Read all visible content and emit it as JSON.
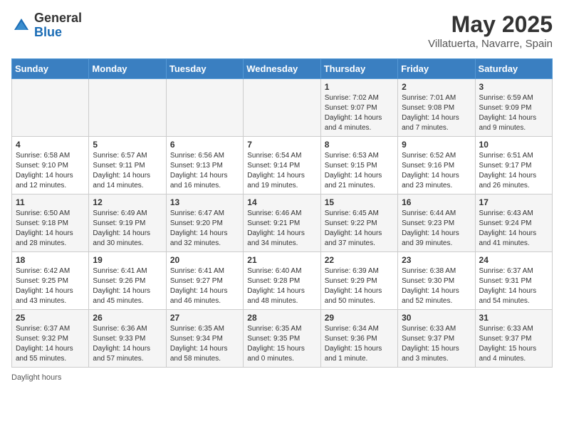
{
  "header": {
    "logo_general": "General",
    "logo_blue": "Blue",
    "month": "May 2025",
    "location": "Villatuerta, Navarre, Spain"
  },
  "weekdays": [
    "Sunday",
    "Monday",
    "Tuesday",
    "Wednesday",
    "Thursday",
    "Friday",
    "Saturday"
  ],
  "footer": {
    "daylight_label": "Daylight hours"
  },
  "weeks": [
    [
      {
        "day": "",
        "info": ""
      },
      {
        "day": "",
        "info": ""
      },
      {
        "day": "",
        "info": ""
      },
      {
        "day": "",
        "info": ""
      },
      {
        "day": "1",
        "info": "Sunrise: 7:02 AM\nSunset: 9:07 PM\nDaylight: 14 hours\nand 4 minutes."
      },
      {
        "day": "2",
        "info": "Sunrise: 7:01 AM\nSunset: 9:08 PM\nDaylight: 14 hours\nand 7 minutes."
      },
      {
        "day": "3",
        "info": "Sunrise: 6:59 AM\nSunset: 9:09 PM\nDaylight: 14 hours\nand 9 minutes."
      }
    ],
    [
      {
        "day": "4",
        "info": "Sunrise: 6:58 AM\nSunset: 9:10 PM\nDaylight: 14 hours\nand 12 minutes."
      },
      {
        "day": "5",
        "info": "Sunrise: 6:57 AM\nSunset: 9:11 PM\nDaylight: 14 hours\nand 14 minutes."
      },
      {
        "day": "6",
        "info": "Sunrise: 6:56 AM\nSunset: 9:13 PM\nDaylight: 14 hours\nand 16 minutes."
      },
      {
        "day": "7",
        "info": "Sunrise: 6:54 AM\nSunset: 9:14 PM\nDaylight: 14 hours\nand 19 minutes."
      },
      {
        "day": "8",
        "info": "Sunrise: 6:53 AM\nSunset: 9:15 PM\nDaylight: 14 hours\nand 21 minutes."
      },
      {
        "day": "9",
        "info": "Sunrise: 6:52 AM\nSunset: 9:16 PM\nDaylight: 14 hours\nand 23 minutes."
      },
      {
        "day": "10",
        "info": "Sunrise: 6:51 AM\nSunset: 9:17 PM\nDaylight: 14 hours\nand 26 minutes."
      }
    ],
    [
      {
        "day": "11",
        "info": "Sunrise: 6:50 AM\nSunset: 9:18 PM\nDaylight: 14 hours\nand 28 minutes."
      },
      {
        "day": "12",
        "info": "Sunrise: 6:49 AM\nSunset: 9:19 PM\nDaylight: 14 hours\nand 30 minutes."
      },
      {
        "day": "13",
        "info": "Sunrise: 6:47 AM\nSunset: 9:20 PM\nDaylight: 14 hours\nand 32 minutes."
      },
      {
        "day": "14",
        "info": "Sunrise: 6:46 AM\nSunset: 9:21 PM\nDaylight: 14 hours\nand 34 minutes."
      },
      {
        "day": "15",
        "info": "Sunrise: 6:45 AM\nSunset: 9:22 PM\nDaylight: 14 hours\nand 37 minutes."
      },
      {
        "day": "16",
        "info": "Sunrise: 6:44 AM\nSunset: 9:23 PM\nDaylight: 14 hours\nand 39 minutes."
      },
      {
        "day": "17",
        "info": "Sunrise: 6:43 AM\nSunset: 9:24 PM\nDaylight: 14 hours\nand 41 minutes."
      }
    ],
    [
      {
        "day": "18",
        "info": "Sunrise: 6:42 AM\nSunset: 9:25 PM\nDaylight: 14 hours\nand 43 minutes."
      },
      {
        "day": "19",
        "info": "Sunrise: 6:41 AM\nSunset: 9:26 PM\nDaylight: 14 hours\nand 45 minutes."
      },
      {
        "day": "20",
        "info": "Sunrise: 6:41 AM\nSunset: 9:27 PM\nDaylight: 14 hours\nand 46 minutes."
      },
      {
        "day": "21",
        "info": "Sunrise: 6:40 AM\nSunset: 9:28 PM\nDaylight: 14 hours\nand 48 minutes."
      },
      {
        "day": "22",
        "info": "Sunrise: 6:39 AM\nSunset: 9:29 PM\nDaylight: 14 hours\nand 50 minutes."
      },
      {
        "day": "23",
        "info": "Sunrise: 6:38 AM\nSunset: 9:30 PM\nDaylight: 14 hours\nand 52 minutes."
      },
      {
        "day": "24",
        "info": "Sunrise: 6:37 AM\nSunset: 9:31 PM\nDaylight: 14 hours\nand 54 minutes."
      }
    ],
    [
      {
        "day": "25",
        "info": "Sunrise: 6:37 AM\nSunset: 9:32 PM\nDaylight: 14 hours\nand 55 minutes."
      },
      {
        "day": "26",
        "info": "Sunrise: 6:36 AM\nSunset: 9:33 PM\nDaylight: 14 hours\nand 57 minutes."
      },
      {
        "day": "27",
        "info": "Sunrise: 6:35 AM\nSunset: 9:34 PM\nDaylight: 14 hours\nand 58 minutes."
      },
      {
        "day": "28",
        "info": "Sunrise: 6:35 AM\nSunset: 9:35 PM\nDaylight: 15 hours\nand 0 minutes."
      },
      {
        "day": "29",
        "info": "Sunrise: 6:34 AM\nSunset: 9:36 PM\nDaylight: 15 hours\nand 1 minute."
      },
      {
        "day": "30",
        "info": "Sunrise: 6:33 AM\nSunset: 9:37 PM\nDaylight: 15 hours\nand 3 minutes."
      },
      {
        "day": "31",
        "info": "Sunrise: 6:33 AM\nSunset: 9:37 PM\nDaylight: 15 hours\nand 4 minutes."
      }
    ]
  ]
}
